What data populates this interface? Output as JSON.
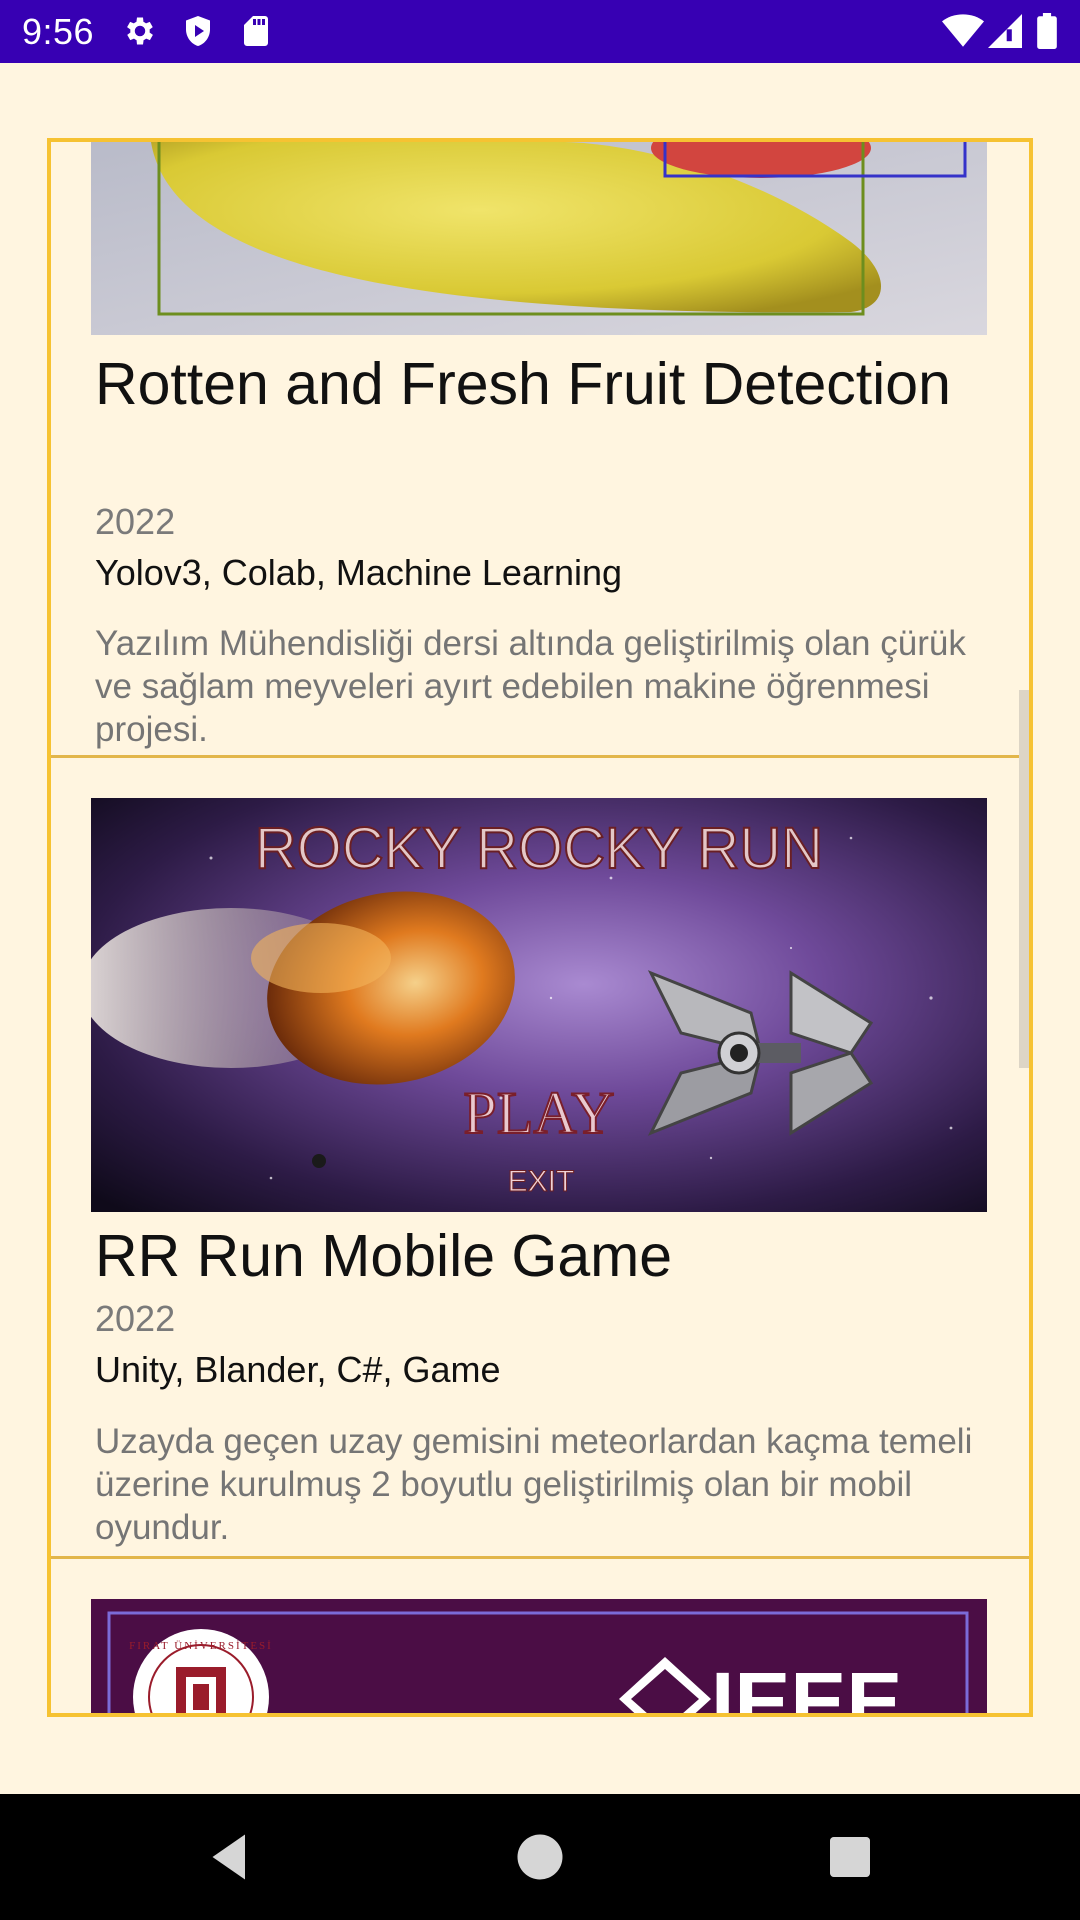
{
  "status_bar": {
    "time": "9:56",
    "icons": [
      "settings-icon",
      "play-protect-icon",
      "sd-card-icon",
      "wifi-icon",
      "cell-signal-icon",
      "battery-icon"
    ]
  },
  "projects": [
    {
      "title": "Rotten and Fresh Fruit Detection",
      "year": "2022",
      "tags": "Yolov3, Colab, Machine Learning",
      "description": "Yazılım Mühendisliği dersi altında geliştirilmiş olan çürük ve sağlam meyveleri ayırt edebilen makine öğrenmesi projesi."
    },
    {
      "title": "RR Run Mobile Game",
      "year": "2022",
      "tags": "Unity, Blander, C#, Game",
      "description": "Uzayda geçen uzay gemisini meteorlardan kaçma temeli üzerine kurulmuş 2 boyutlu geliştirilmiş olan bir mobil oyundur.",
      "image_text": {
        "title": "ROCKY ROCKY RUN",
        "play": "PLAY",
        "exit": "EXIT"
      }
    },
    {
      "image_text": {
        "logo": "IEEE",
        "seal": "FIRAT ÜNİVERSİTESİ"
      }
    }
  ],
  "nav_bar": {
    "back": "back-icon",
    "home": "home-icon",
    "recents": "recents-icon"
  },
  "colors": {
    "status_bar": "#3700b3",
    "background": "#fff5e0",
    "panel_border": "#f6c232",
    "title": "#111111",
    "muted": "#757575"
  }
}
